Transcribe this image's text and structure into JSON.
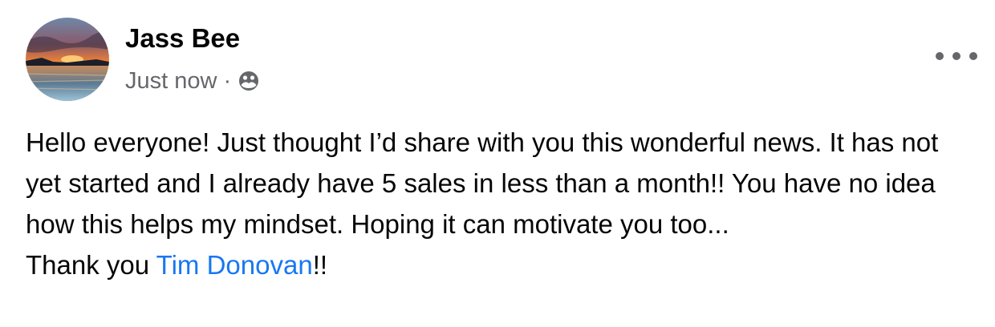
{
  "post": {
    "author": "Jass Bee",
    "timestamp": "Just now",
    "separator": "·",
    "audience_icon": "friends-icon",
    "more_icon": "more-options-icon",
    "paragraph": "Hello everyone! Just thought I’d share with you this wonderful news. It has not yet started and I already have 5 sales in less than a month!! You have no idea how this helps my mindset. Hoping it can motivate you too...",
    "thanks_prefix": "Thank you ",
    "mention": "Tim Donovan",
    "thanks_suffix": "!!"
  },
  "colors": {
    "link": "#1877f2",
    "meta": "#65676b",
    "text": "#050505"
  }
}
